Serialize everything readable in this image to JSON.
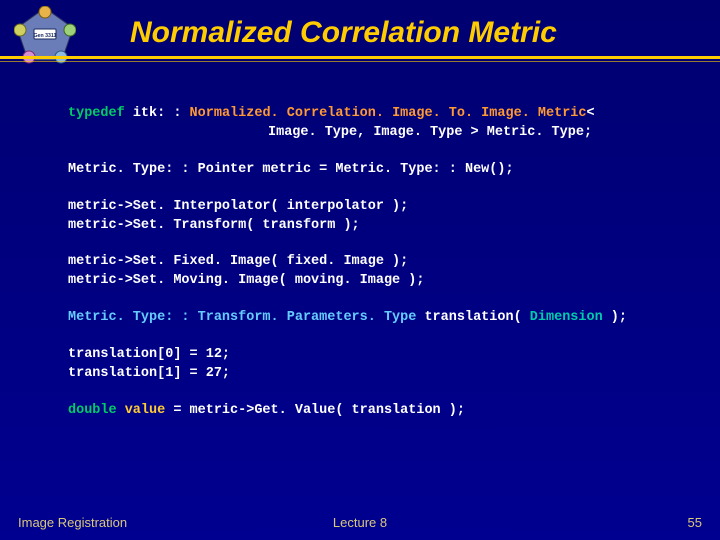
{
  "title": "Normalized Correlation Metric",
  "logo_label": "Gen 3311",
  "code": {
    "l1a": "typedef",
    "l1b": " itk: :",
    "l1c": " Normalized. Correlation. Image. To. Image. Metric",
    "l1d": "<",
    "l2a": "Image. Type, Image. Type >",
    "l2b": "  Metric. Type;",
    "l3": "Metric. Type: : Pointer metric = Metric. Type: : New();",
    "l4": "metric->Set. Interpolator( interpolator );",
    "l5": "metric->Set. Transform( transform );",
    "l6a": "metric->Set. Fixed. Image(   fixed. Image  );",
    "l6b": "metric->Set. Moving. Image(  moving. Image );",
    "l7a": "Metric. Type: : Transform. Parameters. Type",
    "l7b": " translation(",
    "l7c": " Dimension",
    "l7d": " );",
    "l8": "translation[0] = 12;",
    "l9": "translation[1] = 27;",
    "l10a": "double",
    "l10b": " value",
    "l10c": " = metric->Get. Value( translation );"
  },
  "footer": {
    "left": "Image Registration",
    "center": "Lecture 8",
    "right": "55"
  }
}
